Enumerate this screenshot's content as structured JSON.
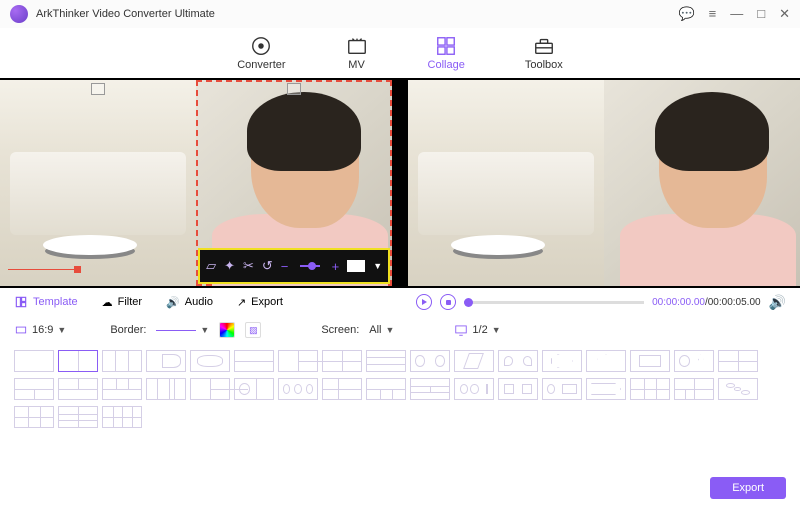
{
  "app": {
    "title": "ArkThinker Video Converter Ultimate"
  },
  "tabs": [
    {
      "label": "Converter",
      "active": false
    },
    {
      "label": "MV",
      "active": false
    },
    {
      "label": "Collage",
      "active": true
    },
    {
      "label": "Toolbox",
      "active": false
    }
  ],
  "tools": {
    "template": "Template",
    "filter": "Filter",
    "audio": "Audio",
    "export": "Export"
  },
  "player": {
    "current": "00:00:00.00",
    "total": "00:00:05.00"
  },
  "options": {
    "aspect": "16:9",
    "borderLabel": "Border:",
    "screenLabel": "Screen:",
    "screenValue": "All",
    "pageValue": "1/2"
  },
  "footer": {
    "export": "Export"
  },
  "colors": {
    "accent": "#8a5cf5"
  }
}
